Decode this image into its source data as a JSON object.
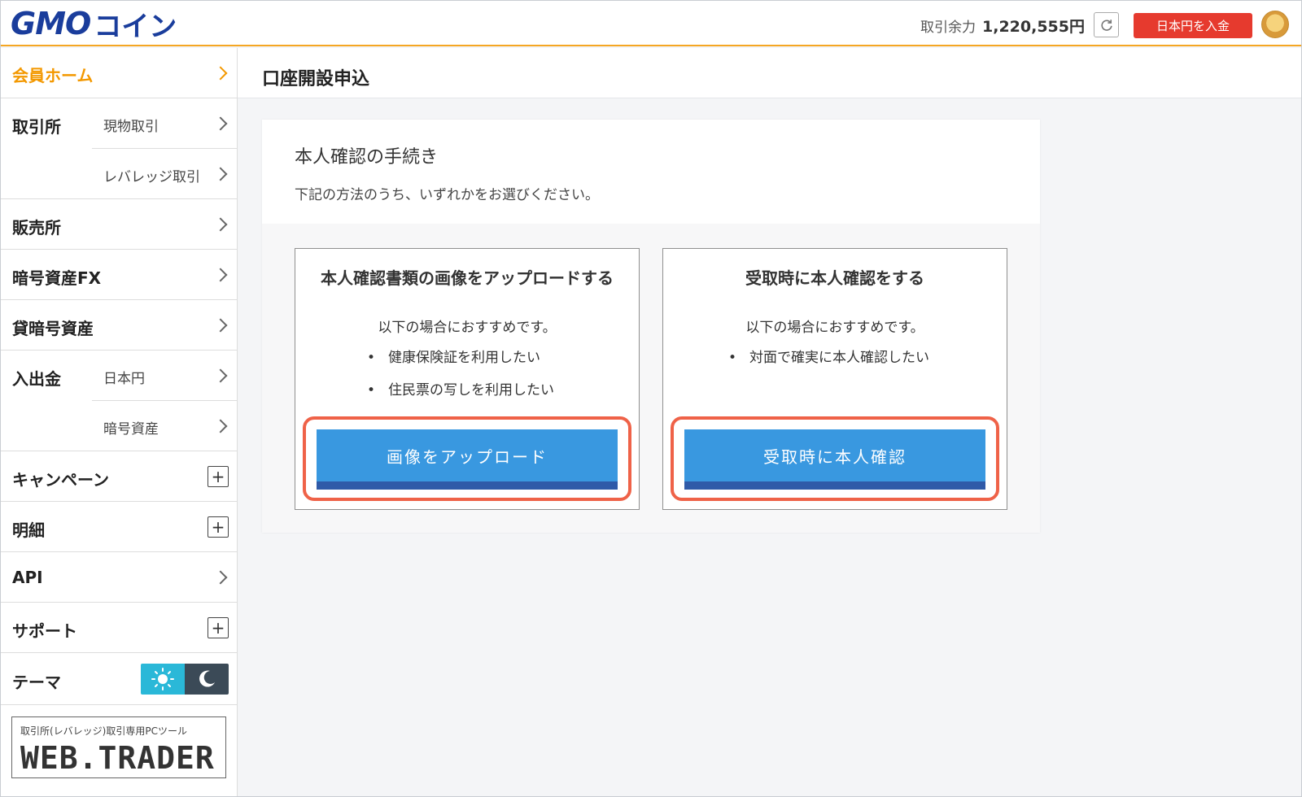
{
  "header": {
    "logo_text_latin": "GMO",
    "logo_text_kana": "コイン",
    "balance_label": "取引余力",
    "balance_value": "1,220,555円",
    "deposit_label": "日本円を入金"
  },
  "sidebar": {
    "home": "会員ホーム",
    "exchange": {
      "label": "取引所",
      "sub": [
        "現物取引",
        "レバレッジ取引"
      ]
    },
    "sales": "販売所",
    "fx": "暗号資産FX",
    "lending": "貸暗号資産",
    "inout": {
      "label": "入出金",
      "sub": [
        "日本円",
        "暗号資産"
      ]
    },
    "campaign": "キャンペーン",
    "statement": "明細",
    "api": "API",
    "support": "サポート",
    "theme": "テーマ",
    "webtrader_caption": "取引所(レバレッジ)取引専用PCツール",
    "webtrader_logo": "WEB.TRADER"
  },
  "main": {
    "page_title": "口座開設申込",
    "card_title": "本人確認の手続き",
    "card_desc": "下記の方法のうち、いずれかをお選びください。",
    "options": [
      {
        "title": "本人確認書類の画像をアップロードする",
        "lead": "以下の場合におすすめです。",
        "bullets": [
          "健康保険証を利用したい",
          "住民票の写しを利用したい"
        ],
        "button": "画像をアップロード"
      },
      {
        "title": "受取時に本人確認をする",
        "lead": "以下の場合におすすめです。",
        "bullets": [
          "対面で確実に本人確認したい"
        ],
        "button": "受取時に本人確認"
      }
    ]
  },
  "colors": {
    "accent_orange": "#f5a623",
    "brand_blue": "#1a3d9c",
    "deposit_red": "#e63a2e",
    "button_blue": "#3998e0",
    "highlight_red": "#ef6248"
  }
}
